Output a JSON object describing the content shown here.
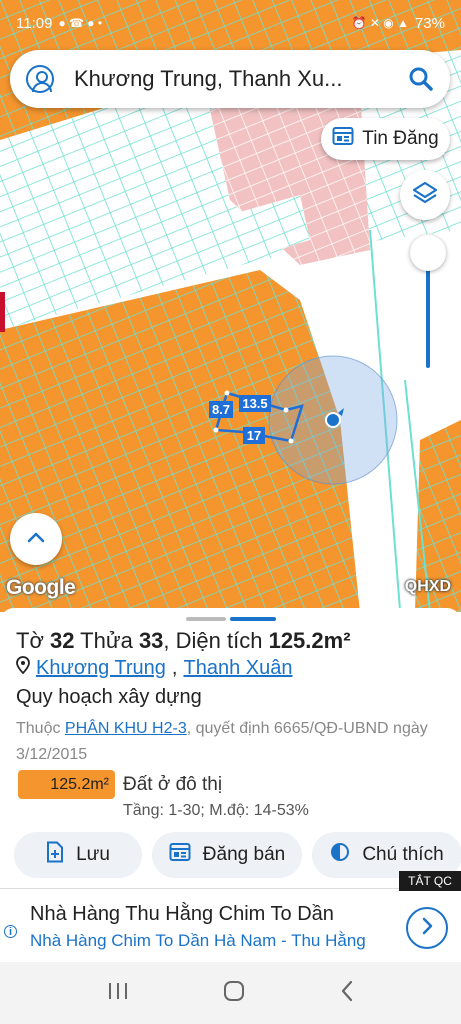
{
  "status_bar": {
    "time": "11:09",
    "battery": "73%"
  },
  "search": {
    "query": "Khương Trung, Thanh Xu..."
  },
  "map": {
    "tin_dang_label": "Tin Đăng",
    "google_label": "Google",
    "layer_label": "QHXD",
    "parcel_dims": {
      "top": "13.5",
      "left": "8.7",
      "bottom": "17"
    },
    "colors": {
      "residential": "#f4952e",
      "boundary": "#6de0d0",
      "public": "#f2c2c2"
    }
  },
  "parcel": {
    "title_prefix": "Tờ ",
    "sheet_no": "32",
    "plot_prefix": " Thửa ",
    "plot_no": "33",
    "area_prefix": ", Diện tích ",
    "area": "125.2m²",
    "ward": "Khương Trung",
    "district": "Thanh Xuân",
    "planning_title": "Quy hoạch xây dựng",
    "planning_desc_prefix": "Thuộc ",
    "planning_zone": "PHÂN KHU H2-3",
    "planning_desc_suffix": ", quyết định 6665/QĐ-UBND ngày 3/12/2015",
    "badge_area": "125.2m²",
    "land_type": "Đất ở đô thị",
    "land_detail": "Tầng: 1-30; M.độ: 14-53%"
  },
  "actions": {
    "save": "Lưu",
    "post_sale": "Đăng bán",
    "legend": "Chú thích"
  },
  "ad": {
    "close_label": "TẮT QC",
    "headline": "Nhà Hàng Thu Hằng Chim To Dần",
    "subline": "Nhà Hàng Chim To Dần Hà Nam - Thu Hằng"
  }
}
